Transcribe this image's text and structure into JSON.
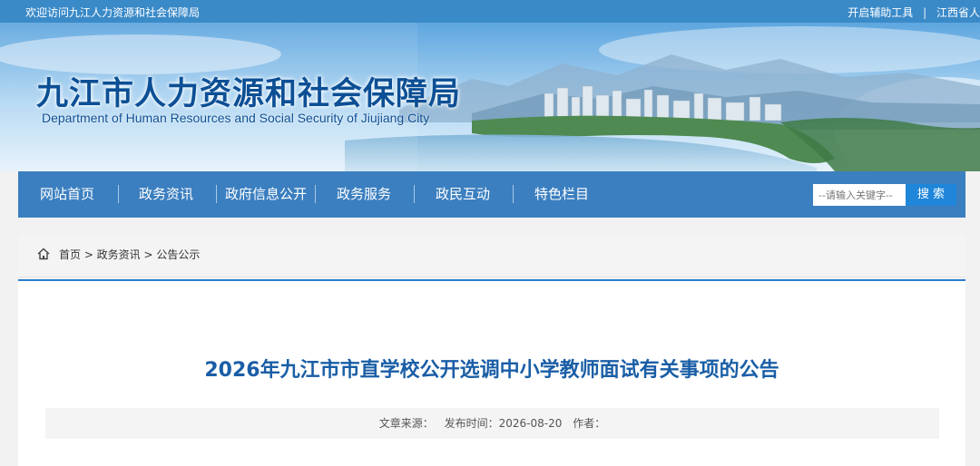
{
  "topbar": {
    "welcome": "欢迎访问九江人力资源和社会保障局",
    "accessibility_tool": "开启辅助工具",
    "separator": "|",
    "province_link": "江西省人"
  },
  "banner": {
    "title_cn": "九江市人力资源和社会保障局",
    "title_en": "Department of Human Resources and Social Security of Jiujiang City"
  },
  "nav": {
    "items": [
      "网站首页",
      "政务资讯",
      "政府信息公开",
      "政务服务",
      "政民互动",
      "特色栏目"
    ]
  },
  "search": {
    "placeholder": "--请输入关键字--",
    "button": "搜 索"
  },
  "breadcrumb": {
    "icon": "home-icon",
    "text": "首页 > 政务资讯 > 公告公示"
  },
  "article": {
    "title": "2026年九江市市直学校公开选调中小学教师面试有关事项的公告",
    "source_label": "文章来源：",
    "date_label": "发布时间：2026-08-20",
    "author_label": "作者："
  },
  "colors": {
    "topbar": "#3a8ac8",
    "nav": "#3b7fc0",
    "search_button": "#1f86d9",
    "title": "#1a5ea6",
    "banner_title": "#0c4f95"
  }
}
